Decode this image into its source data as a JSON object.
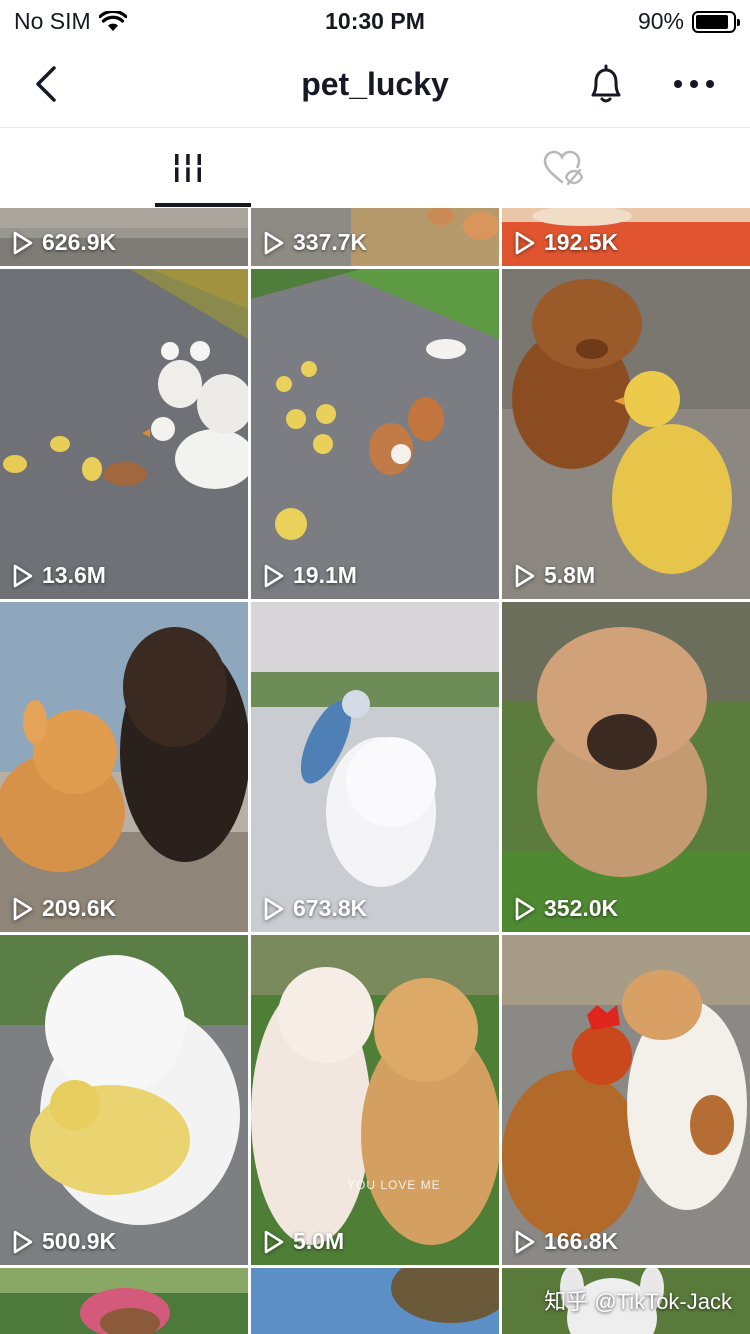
{
  "status_bar": {
    "carrier": "No SIM",
    "time": "10:30 PM",
    "battery": "90%",
    "battery_level": 0.9
  },
  "navbar": {
    "title": "pet_lucky",
    "back_icon": "chevron-left-icon",
    "bell_icon": "bell-icon",
    "more_icon": "more-horizontal-icon"
  },
  "tabs": [
    {
      "name": "videos",
      "icon": "grid-bars-icon",
      "active": true
    },
    {
      "name": "liked",
      "icon": "heart-hidden-icon",
      "active": false
    }
  ],
  "videos": [
    {
      "views": "626.9K"
    },
    {
      "views": "337.7K"
    },
    {
      "views": "192.5K"
    },
    {
      "views": "13.6M"
    },
    {
      "views": "19.1M"
    },
    {
      "views": "5.8M"
    },
    {
      "views": "209.6K"
    },
    {
      "views": "673.8K"
    },
    {
      "views": "352.0K"
    },
    {
      "views": "500.9K"
    },
    {
      "views": "5.0M",
      "caption": "YOU LOVE ME"
    },
    {
      "views": "166.8K"
    },
    {
      "views": ""
    },
    {
      "views": ""
    },
    {
      "views": ""
    }
  ],
  "watermark": "知乎 @TikTok-Jack",
  "colors": {
    "text": "#161823",
    "divider": "#e6e6e6",
    "tab_indicator": "#161823"
  }
}
